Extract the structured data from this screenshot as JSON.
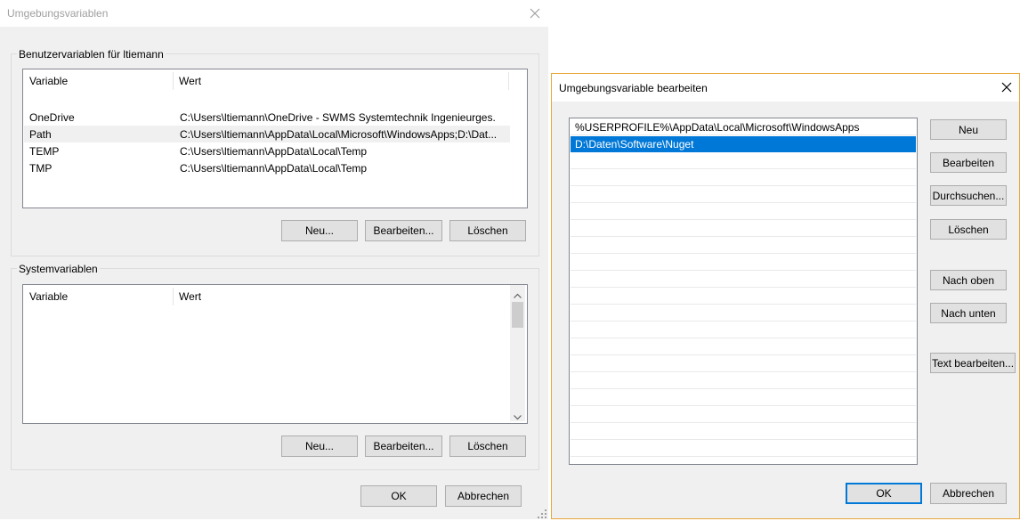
{
  "dialog1": {
    "title": "Umgebungsvariablen",
    "user_group": {
      "label": "Benutzervariablen für ltiemann",
      "columns": [
        "Variable",
        "Wert"
      ],
      "rows": [
        {
          "variable": "OneDrive",
          "value": "C:\\Users\\ltiemann\\OneDrive - SWMS Systemtechnik Ingenieurges."
        },
        {
          "variable": "Path",
          "value": "C:\\Users\\ltiemann\\AppData\\Local\\Microsoft\\WindowsApps;D:\\Dat..."
        },
        {
          "variable": "TEMP",
          "value": "C:\\Users\\ltiemann\\AppData\\Local\\Temp"
        },
        {
          "variable": "TMP",
          "value": "C:\\Users\\ltiemann\\AppData\\Local\\Temp"
        }
      ],
      "selected_row": "Path",
      "buttons": {
        "new": "Neu...",
        "edit": "Bearbeiten...",
        "delete": "Löschen"
      }
    },
    "system_group": {
      "label": "Systemvariablen",
      "columns": [
        "Variable",
        "Wert"
      ],
      "buttons": {
        "new": "Neu...",
        "edit": "Bearbeiten...",
        "delete": "Löschen"
      }
    },
    "ok": "OK",
    "cancel": "Abbrechen"
  },
  "dialog2": {
    "title": "Umgebungsvariable bearbeiten",
    "entries": [
      "%USERPROFILE%\\AppData\\Local\\Microsoft\\WindowsApps",
      "D:\\Daten\\Software\\Nuget"
    ],
    "selected_entry": "D:\\Daten\\Software\\Nuget",
    "buttons": {
      "new": "Neu",
      "edit": "Bearbeiten",
      "browse": "Durchsuchen...",
      "delete": "Löschen",
      "up": "Nach oben",
      "down": "Nach unten",
      "text_edit": "Text bearbeiten..."
    },
    "ok": "OK",
    "cancel": "Abbrechen"
  },
  "colors": {
    "selection": "#0078d7",
    "focus_border": "#e8a73a",
    "dialog_bg": "#f0f0f0"
  }
}
